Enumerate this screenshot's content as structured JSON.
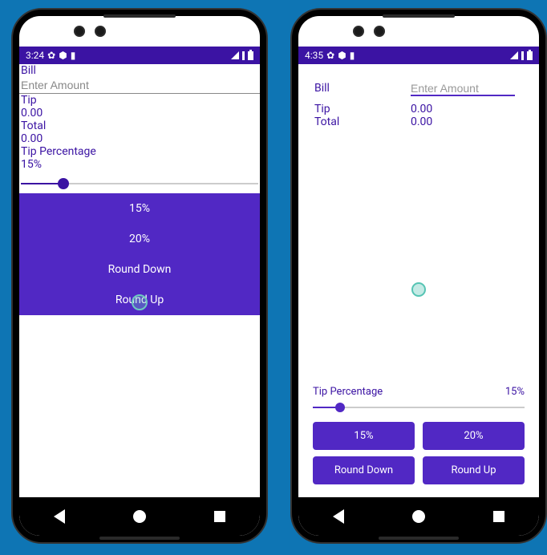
{
  "left": {
    "statusbar": {
      "time": "3:24"
    },
    "bill_label": "Bill",
    "bill_placeholder": "Enter Amount",
    "tip_label": "Tip",
    "tip_value": "0.00",
    "total_label": "Total",
    "total_value": "0.00",
    "tip_pct_label": "Tip Percentage",
    "tip_pct_value": "15%",
    "buttons": {
      "b15": "15%",
      "b20": "20%",
      "round_down": "Round Down",
      "round_up": "Round Up"
    }
  },
  "right": {
    "statusbar": {
      "time": "4:35"
    },
    "bill_label": "Bill",
    "bill_placeholder": "Enter Amount",
    "tip_label": "Tip",
    "tip_value": "0.00",
    "total_label": "Total",
    "total_value": "0.00",
    "tip_pct_label": "Tip Percentage",
    "tip_pct_value": "15%",
    "buttons": {
      "b15": "15%",
      "b20": "20%",
      "round_down": "Round Down",
      "round_up": "Round Up"
    }
  }
}
